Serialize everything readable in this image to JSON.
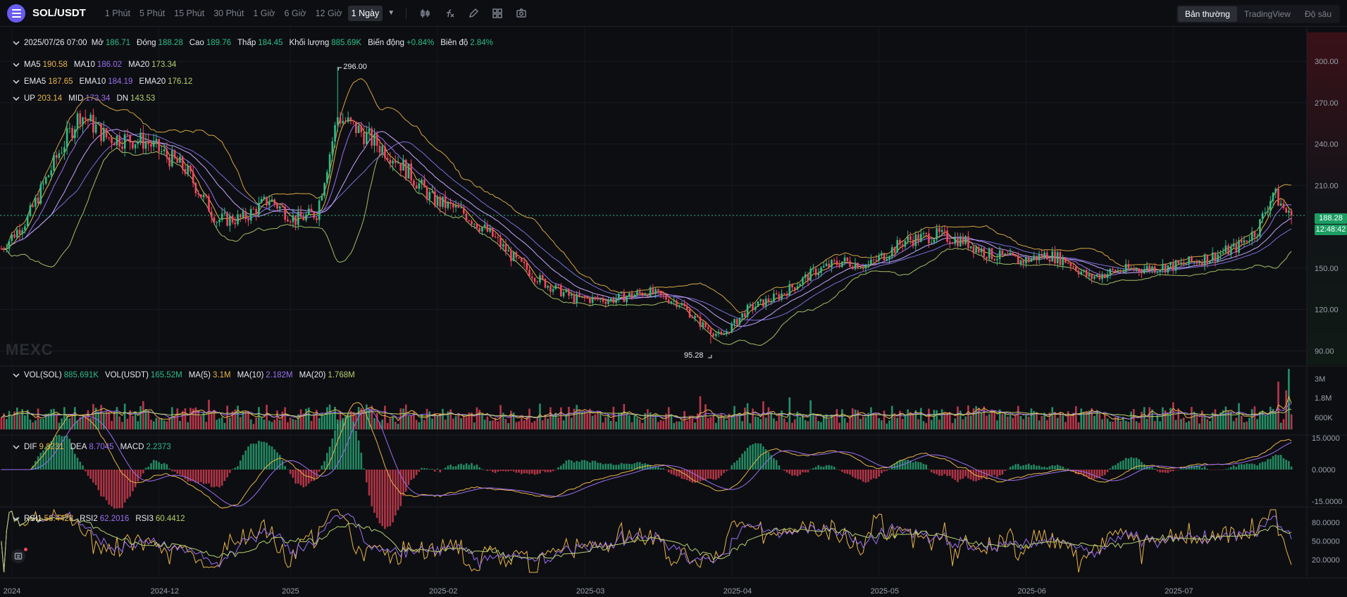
{
  "toolbar": {
    "pair": "SOL/USDT",
    "timeframes": [
      "1 Phút",
      "5 Phút",
      "15 Phút",
      "30 Phút",
      "1 Giờ",
      "6 Giờ",
      "12 Giờ",
      "1 Ngày"
    ],
    "active_timeframe": "1 Ngày",
    "tool_icons": [
      "candle-type-icon",
      "indicator-fx-icon",
      "draw-pencil-icon",
      "layout-grid-icon",
      "camera-icon"
    ],
    "modes": [
      "Bản thường",
      "TradingView",
      "Độ sâu"
    ],
    "active_mode": "Bản thường"
  },
  "ohlc": {
    "date": "2025/07/26 07:00",
    "open_label": "Mở",
    "open": "186.71",
    "close_label": "Đóng",
    "close": "188.28",
    "high_label": "Cao",
    "high": "189.76",
    "low_label": "Thấp",
    "low": "184.45",
    "volume_label": "Khối lượng",
    "volume": "885.69K",
    "change_label": "Biến động",
    "change": "+0.84%",
    "amplitude_label": "Biên độ",
    "amplitude": "2.84%"
  },
  "ma": {
    "ma5_label": "MA5",
    "ma5": "190.58",
    "ma10_label": "MA10",
    "ma10": "186.02",
    "ma20_label": "MA20",
    "ma20": "173.34"
  },
  "ema": {
    "ema5_label": "EMA5",
    "ema5": "187.65",
    "ema10_label": "EMA10",
    "ema10": "184.19",
    "ema20_label": "EMA20",
    "ema20": "176.12"
  },
  "boll": {
    "up_label": "UP",
    "up": "203.14",
    "mid_label": "MID",
    "mid": "173.34",
    "dn_label": "DN",
    "dn": "143.53"
  },
  "vol": {
    "vol_sol_label": "VOL(SOL)",
    "vol_sol": "885.691K",
    "vol_usdt_label": "VOL(USDT)",
    "vol_usdt": "165.52M",
    "ma5_label": "MA(5)",
    "ma5": "3.1M",
    "ma10_label": "MA(10)",
    "ma10": "2.182M",
    "ma20_label": "MA(20)",
    "ma20": "1.768M"
  },
  "macd": {
    "dif_label": "DIF",
    "dif": "9.8231",
    "dea_label": "DEA",
    "dea": "8.7045",
    "macd_label": "MACD",
    "macd": "2.2373"
  },
  "rsi": {
    "rsi1_label": "RSI1",
    "rsi1": "58.4428",
    "rsi2_label": "RSI2",
    "rsi2": "62.2016",
    "rsi3_label": "RSI3",
    "rsi3": "60.4412"
  },
  "price_axis": [
    "300.00",
    "270.00",
    "240.00",
    "210.00",
    "150.00",
    "120.00",
    "90.00"
  ],
  "vol_axis": [
    "3M",
    "1.8M",
    "600K"
  ],
  "macd_axis": [
    "15.0000",
    "0.0000",
    "-15.0000"
  ],
  "rsi_axis": [
    "80.0000",
    "50.0000",
    "20.0000"
  ],
  "time_axis": [
    "2024",
    "2024-12",
    "2025",
    "2025-02",
    "2025-03",
    "2025-04",
    "2025-05",
    "2025-06",
    "2025-07"
  ],
  "high_marker": "296.00",
  "low_marker": "95.28",
  "last_price": "188.28",
  "countdown": "12:48:42",
  "watermark": "MEXC",
  "colors": {
    "up": "#2ebd85",
    "down": "#f6465d",
    "accent": "#6a5cf0",
    "ma5": "#e8b54a",
    "ma10": "#9b6ff0",
    "ma20": "#b5d06d"
  },
  "chart_data": {
    "type": "candlestick",
    "price_anchors": [
      [
        0,
        164
      ],
      [
        10,
        186
      ],
      [
        22,
        234
      ],
      [
        30,
        262
      ],
      [
        40,
        245
      ],
      [
        55,
        242
      ],
      [
        70,
        222
      ],
      [
        82,
        185
      ],
      [
        92,
        186
      ],
      [
        102,
        200
      ],
      [
        112,
        185
      ],
      [
        120,
        190
      ],
      [
        128,
        260
      ],
      [
        136,
        250
      ],
      [
        150,
        230
      ],
      [
        164,
        200
      ],
      [
        176,
        190
      ],
      [
        186,
        175
      ],
      [
        196,
        155
      ],
      [
        206,
        140
      ],
      [
        218,
        128
      ],
      [
        232,
        127
      ],
      [
        246,
        133
      ],
      [
        258,
        125
      ],
      [
        266,
        110
      ],
      [
        274,
        100
      ],
      [
        284,
        120
      ],
      [
        296,
        130
      ],
      [
        310,
        148
      ],
      [
        320,
        155
      ],
      [
        330,
        152
      ],
      [
        344,
        170
      ],
      [
        356,
        174
      ],
      [
        366,
        170
      ],
      [
        376,
        160
      ],
      [
        388,
        155
      ],
      [
        398,
        160
      ],
      [
        406,
        155
      ],
      [
        414,
        143
      ],
      [
        424,
        148
      ],
      [
        436,
        150
      ],
      [
        448,
        152
      ],
      [
        460,
        158
      ],
      [
        470,
        165
      ],
      [
        478,
        178
      ],
      [
        484,
        205
      ],
      [
        490,
        188
      ]
    ],
    "x_ticks": [
      "2024",
      "2024-12",
      "2025",
      "2025-02",
      "2025-03",
      "2025-04",
      "2025-05",
      "2025-06",
      "2025-07"
    ],
    "ylim": [
      80,
      320
    ],
    "high": 296.0,
    "low": 95.28,
    "last": 188.28
  }
}
